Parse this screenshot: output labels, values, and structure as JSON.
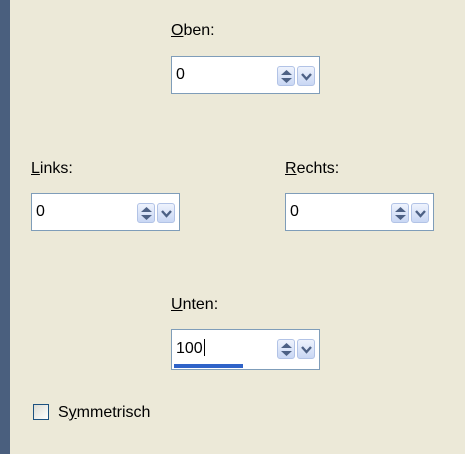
{
  "fields": {
    "oben": {
      "prefix": "O",
      "rest": "ben:",
      "value": "0"
    },
    "links": {
      "prefix": "L",
      "rest": "inks:",
      "value": "0"
    },
    "rechts": {
      "prefix": "R",
      "rest": "echts:",
      "value": "0"
    },
    "unten": {
      "prefix": "U",
      "rest": "nten:",
      "value": "100",
      "progress_percent": 48
    }
  },
  "symmetrisch": {
    "prefix": "S",
    "underlined": "y",
    "rest": "mmetrisch",
    "checked": false
  },
  "icons": {
    "spin": "up-down-arrows-icon",
    "dropdown": "chevron-down-icon"
  },
  "colors": {
    "accent": "#2f63c8",
    "border": "#7f9db9",
    "background": "#ece9d8"
  }
}
